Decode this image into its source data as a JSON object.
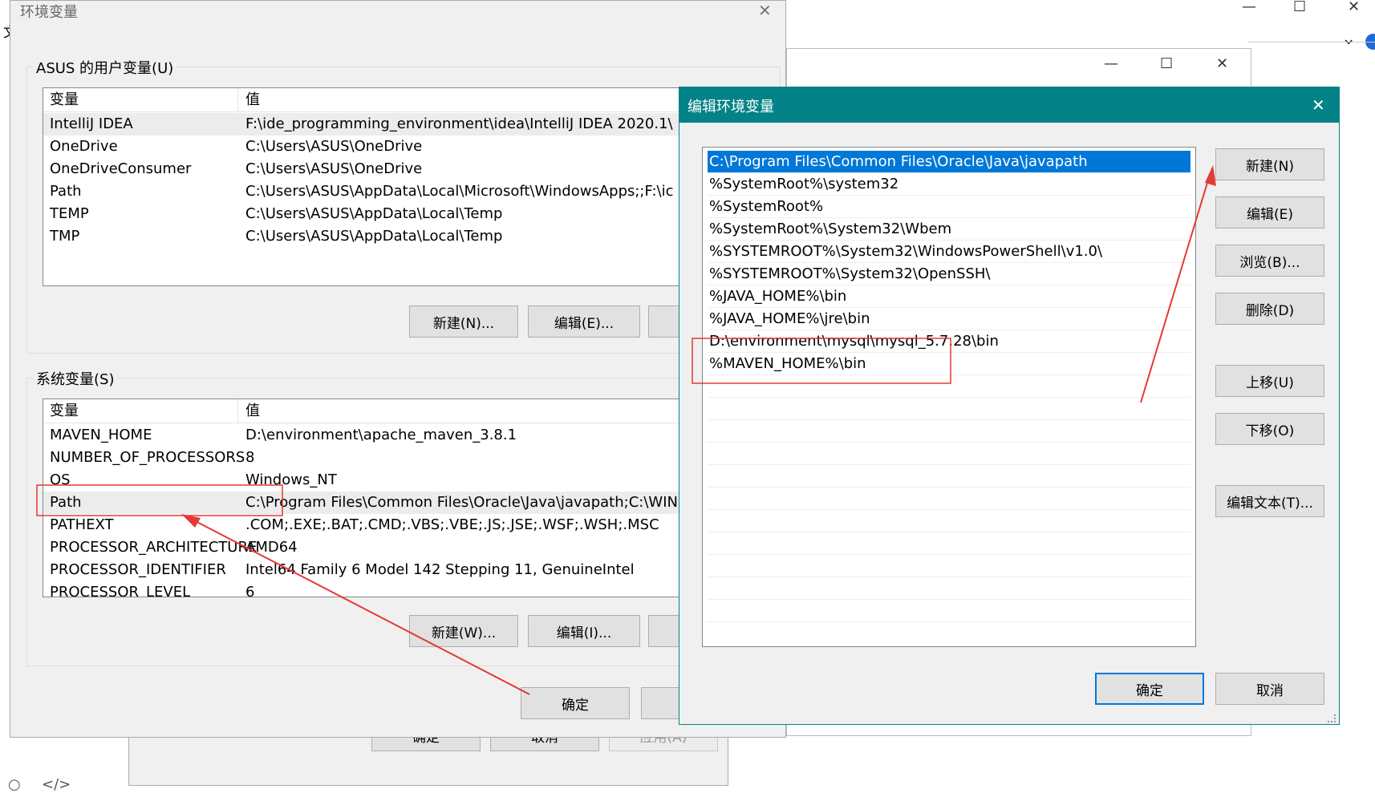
{
  "background_window": {
    "title_fragment": "文",
    "controls": {
      "minimize": "—",
      "maximize": "☐",
      "close": "✕",
      "chevron": "⌄"
    },
    "footer_icons": [
      "○",
      "</>"
    ]
  },
  "middle_window": {
    "controls": {
      "minimize": "—",
      "maximize": "☐",
      "close": "✕"
    },
    "buttons": {
      "ok": "确定",
      "cancel": "取消",
      "apply": "应用(A)"
    }
  },
  "env_dialog": {
    "title": "环境变量",
    "close": "✕",
    "user_group_label": "ASUS 的用户变量(U)",
    "user_table": {
      "headers": [
        "变量",
        "值"
      ],
      "rows": [
        {
          "name": "IntelliJ IDEA",
          "value": "F:\\ide_programming_environment\\idea\\IntelliJ IDEA 2020.1\\"
        },
        {
          "name": "OneDrive",
          "value": "C:\\Users\\ASUS\\OneDrive"
        },
        {
          "name": "OneDriveConsumer",
          "value": "C:\\Users\\ASUS\\OneDrive"
        },
        {
          "name": "Path",
          "value": "C:\\Users\\ASUS\\AppData\\Local\\Microsoft\\WindowsApps;;F:\\ic"
        },
        {
          "name": "TEMP",
          "value": "C:\\Users\\ASUS\\AppData\\Local\\Temp"
        },
        {
          "name": "TMP",
          "value": "C:\\Users\\ASUS\\AppData\\Local\\Temp"
        }
      ]
    },
    "user_buttons": {
      "new": "新建(N)...",
      "edit": "编辑(E)..."
    },
    "system_group_label": "系统变量(S)",
    "system_table": {
      "headers": [
        "变量",
        "值"
      ],
      "rows": [
        {
          "name": "MAVEN_HOME",
          "value": "D:\\environment\\apache_maven_3.8.1"
        },
        {
          "name": "NUMBER_OF_PROCESSORS",
          "value": "8"
        },
        {
          "name": "OS",
          "value": "Windows_NT"
        },
        {
          "name": "Path",
          "value": "C:\\Program Files\\Common Files\\Oracle\\Java\\javapath;C:\\WIN"
        },
        {
          "name": "PATHEXT",
          "value": ".COM;.EXE;.BAT;.CMD;.VBS;.VBE;.JS;.JSE;.WSF;.WSH;.MSC"
        },
        {
          "name": "PROCESSOR_ARCHITECTURE",
          "value": "AMD64"
        },
        {
          "name": "PROCESSOR_IDENTIFIER",
          "value": "Intel64 Family 6 Model 142 Stepping 11, GenuineIntel"
        },
        {
          "name": "PROCESSOR_LEVEL",
          "value": "6"
        }
      ]
    },
    "system_buttons": {
      "new": "新建(W)...",
      "edit": "编辑(I)..."
    },
    "ok": "确定"
  },
  "edit_dialog": {
    "title": "编辑环境变量",
    "close": "✕",
    "entries": [
      "C:\\Program Files\\Common Files\\Oracle\\Java\\javapath",
      "%SystemRoot%\\system32",
      "%SystemRoot%",
      "%SystemRoot%\\System32\\Wbem",
      "%SYSTEMROOT%\\System32\\WindowsPowerShell\\v1.0\\",
      "%SYSTEMROOT%\\System32\\OpenSSH\\",
      "%JAVA_HOME%\\bin",
      "%JAVA_HOME%\\jre\\bin",
      "D:\\environment\\mysql\\mysql_5.7.28\\bin",
      "%MAVEN_HOME%\\bin"
    ],
    "selected_index": 0,
    "empty_rows": 11,
    "buttons": {
      "new": "新建(N)",
      "edit": "编辑(E)",
      "browse": "浏览(B)...",
      "delete": "删除(D)",
      "move_up": "上移(U)",
      "move_down": "下移(O)",
      "edit_text": "编辑文本(T)...",
      "ok": "确定",
      "cancel": "取消"
    }
  },
  "colors": {
    "title_bar": "#038387",
    "selection": "#0078d7",
    "annotation": "#e53935"
  }
}
